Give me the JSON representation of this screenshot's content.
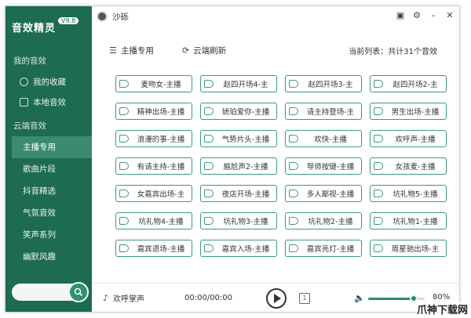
{
  "app": {
    "logo_text": "音效精灵",
    "version": "V9.8",
    "user_name": "沙砾"
  },
  "sidebar": {
    "my_section": "我的音效",
    "my_items": [
      {
        "label": "我的收藏",
        "icon": "heart-icon"
      },
      {
        "label": "本地音效",
        "icon": "folder-icon"
      }
    ],
    "cloud_section": "云端音效",
    "cloud_items": [
      {
        "label": "主播专用",
        "active": true
      },
      {
        "label": "歌曲片段"
      },
      {
        "label": "抖音精选"
      },
      {
        "label": "气氛音效"
      },
      {
        "label": "笑声系列"
      },
      {
        "label": "幽默风趣"
      }
    ],
    "search_placeholder": ""
  },
  "toolbar": {
    "anchor_label": "主播专用",
    "refresh_label": "云端刷新",
    "count_label": "当前列表：共计31个音效"
  },
  "clips": [
    "麦吻女-主播",
    "赵四开场4-主",
    "赵四开场3-主",
    "赵四开场2-主",
    "精神出场-主播",
    "琥珀爱你-主播",
    "请主持登场-主",
    "男生出场-主播",
    "浪漫的事-主播",
    "气势片头-主播",
    "欢快-主播",
    "欢呼声-主播",
    "有请主持-主播",
    "尴尬声2-主播",
    "导师按键-主播",
    "女孩麦-主播",
    "女嘉宾出场-主",
    "夜店开场-主播",
    "多人鄙视-主播",
    "坑礼物5-主播",
    "坑礼物4-主播",
    "坑礼物3-主播",
    "坑礼物2-主播",
    "坑礼物1-主播",
    "嘉宾退场-主播",
    "嘉宾入场-主播",
    "嘉宾亮灯-主播",
    "周星驰出场-主"
  ],
  "player": {
    "current_name": "欢呼掌声",
    "time": "00:00/00:00",
    "volume_label": "80%",
    "volume_value": 80
  },
  "watermark": "爪神下载网",
  "colors": {
    "sidebar": "#1d6b52",
    "accent": "#3d9a77"
  }
}
